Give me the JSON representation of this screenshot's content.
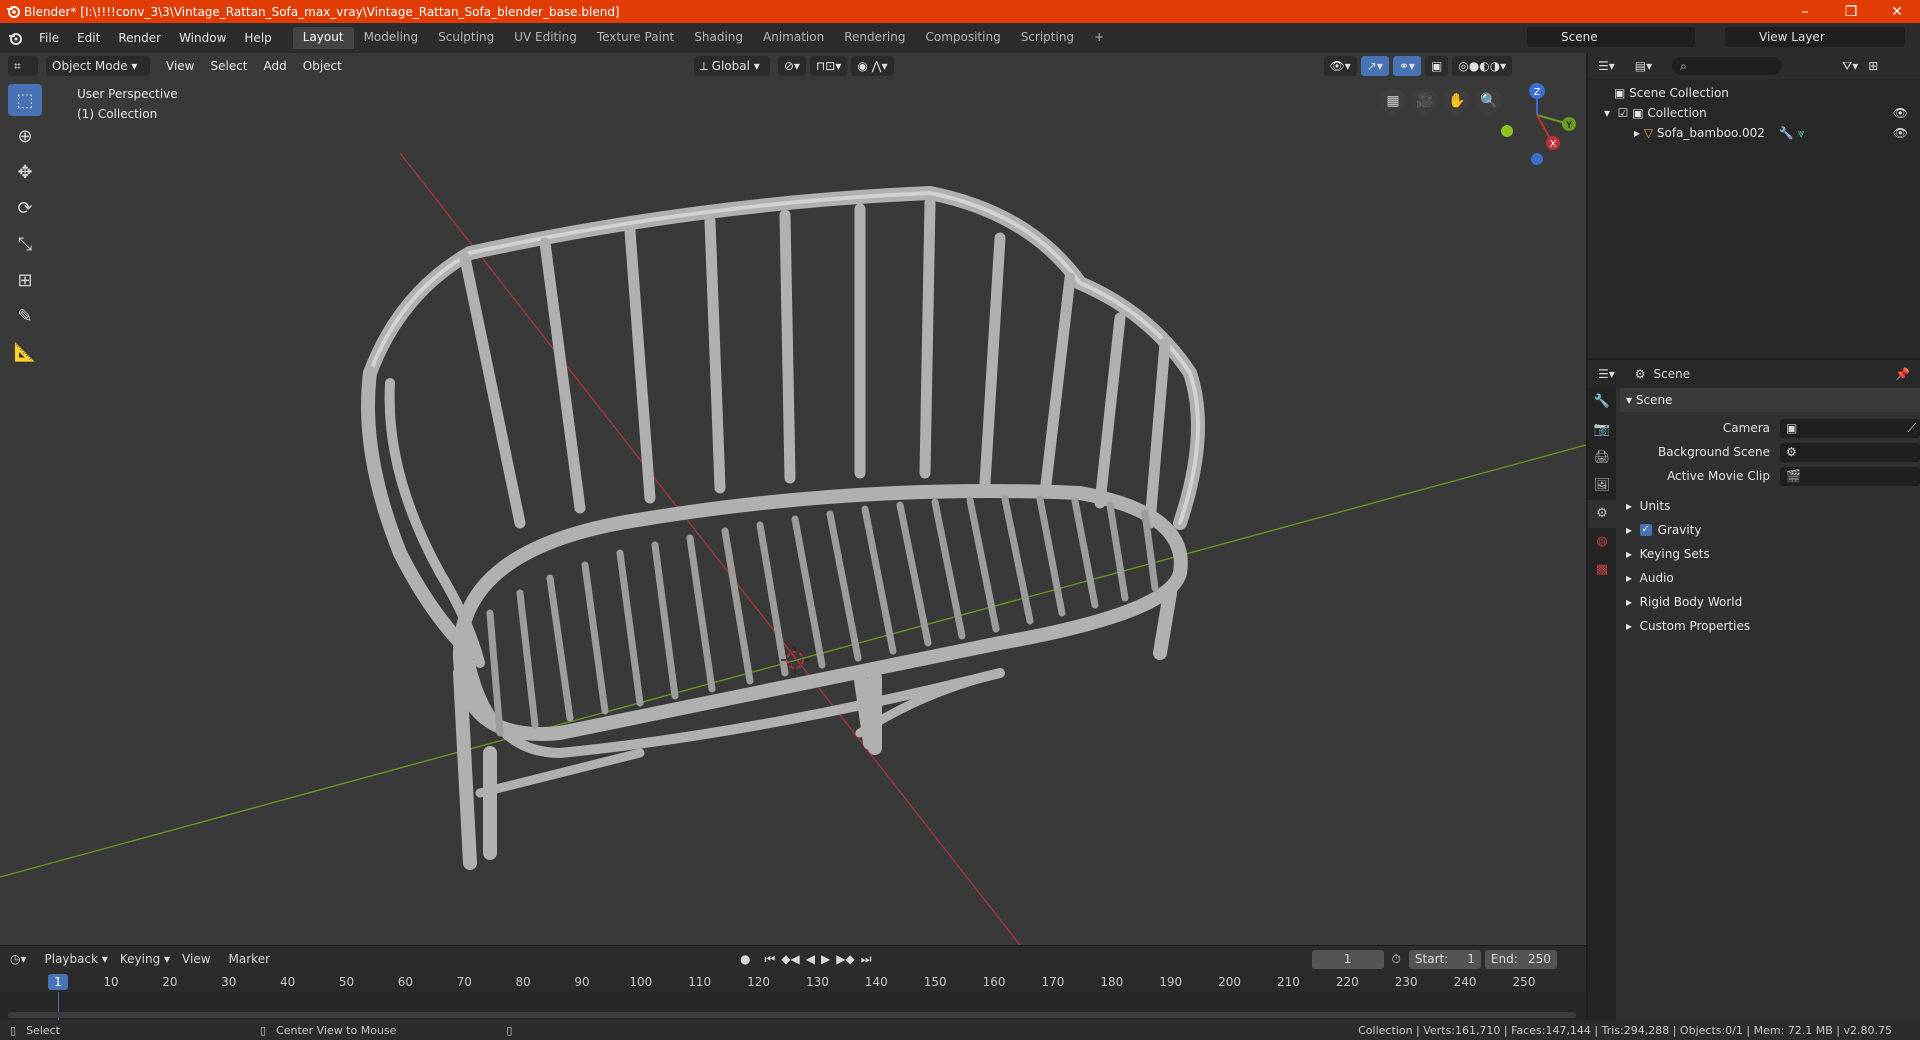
{
  "window": {
    "title": "Blender* [I:\\!!!!conv_3\\3\\Vintage_Rattan_Sofa_max_vray\\Vintage_Rattan_Sofa_blender_base.blend]",
    "minimize": "–",
    "restore": "❐",
    "close": "✕"
  },
  "menu": [
    "File",
    "Edit",
    "Render",
    "Window",
    "Help"
  ],
  "workspaces": [
    "Layout",
    "Modeling",
    "Sculpting",
    "UV Editing",
    "Texture Paint",
    "Shading",
    "Animation",
    "Rendering",
    "Compositing",
    "Scripting"
  ],
  "workspace_add": "+",
  "scene_name": "Scene",
  "view_layer": "View Layer",
  "viewport": {
    "mode": "Object Mode",
    "menus": [
      "View",
      "Select",
      "Add",
      "Object"
    ],
    "orientation": "Global",
    "perspective": "User Perspective",
    "collection": "(1) Collection"
  },
  "gizmo": {
    "z": "Z",
    "y": "Y",
    "x": "X"
  },
  "outliner": {
    "root": "Scene Collection",
    "collection": "Collection",
    "object": "Sofa_bamboo.002"
  },
  "properties": {
    "header": "Scene",
    "section": "Scene",
    "fields": [
      {
        "label": "Camera",
        "value": ""
      },
      {
        "label": "Background Scene",
        "value": ""
      },
      {
        "label": "Active Movie Clip",
        "value": ""
      }
    ],
    "subsections": [
      "Units",
      "Gravity",
      "Keying Sets",
      "Audio",
      "Rigid Body World",
      "Custom Properties"
    ]
  },
  "timeline": {
    "menus": [
      "Playback",
      "Keying",
      "View",
      "Marker"
    ],
    "current_frame": "1",
    "start_label": "Start:",
    "start": "1",
    "end_label": "End:",
    "end": "250",
    "ruler": [
      "1",
      "10",
      "20",
      "30",
      "40",
      "50",
      "60",
      "70",
      "80",
      "90",
      "100",
      "110",
      "120",
      "130",
      "140",
      "150",
      "160",
      "170",
      "180",
      "190",
      "200",
      "210",
      "220",
      "230",
      "240",
      "250"
    ]
  },
  "status": {
    "left": "Select",
    "middle": "Center View to Mouse",
    "right": "Collection | Verts:161,710 | Faces:147,144 | Tris:294,288 | Objects:0/1 | Mem: 72.1 MB | v2.80.75"
  },
  "colors": {
    "accent": "#4772b3",
    "titlebar": "#e03c04",
    "x_axis": "#b03030",
    "y_axis": "#6a9a20"
  }
}
